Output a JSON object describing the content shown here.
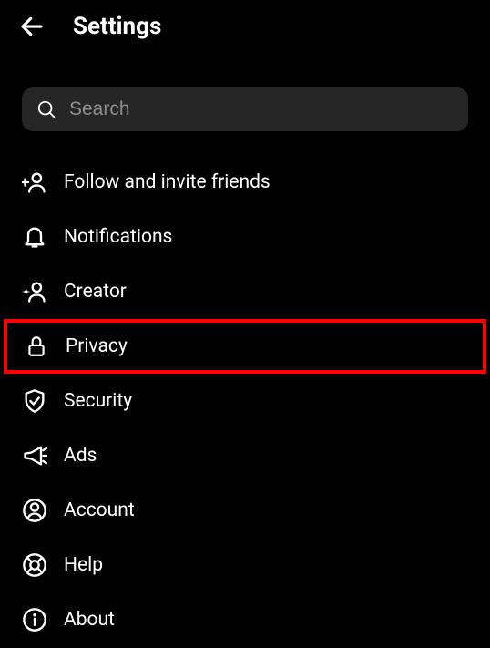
{
  "header": {
    "title": "Settings"
  },
  "search": {
    "placeholder": "Search"
  },
  "menu": {
    "items": [
      {
        "label": "Follow and invite friends",
        "icon": "invite-friends-icon",
        "highlighted": false
      },
      {
        "label": "Notifications",
        "icon": "bell-icon",
        "highlighted": false
      },
      {
        "label": "Creator",
        "icon": "creator-icon",
        "highlighted": false
      },
      {
        "label": "Privacy",
        "icon": "lock-icon",
        "highlighted": true
      },
      {
        "label": "Security",
        "icon": "shield-icon",
        "highlighted": false
      },
      {
        "label": "Ads",
        "icon": "megaphone-icon",
        "highlighted": false
      },
      {
        "label": "Account",
        "icon": "account-icon",
        "highlighted": false
      },
      {
        "label": "Help",
        "icon": "help-icon",
        "highlighted": false
      },
      {
        "label": "About",
        "icon": "info-icon",
        "highlighted": false
      }
    ]
  }
}
